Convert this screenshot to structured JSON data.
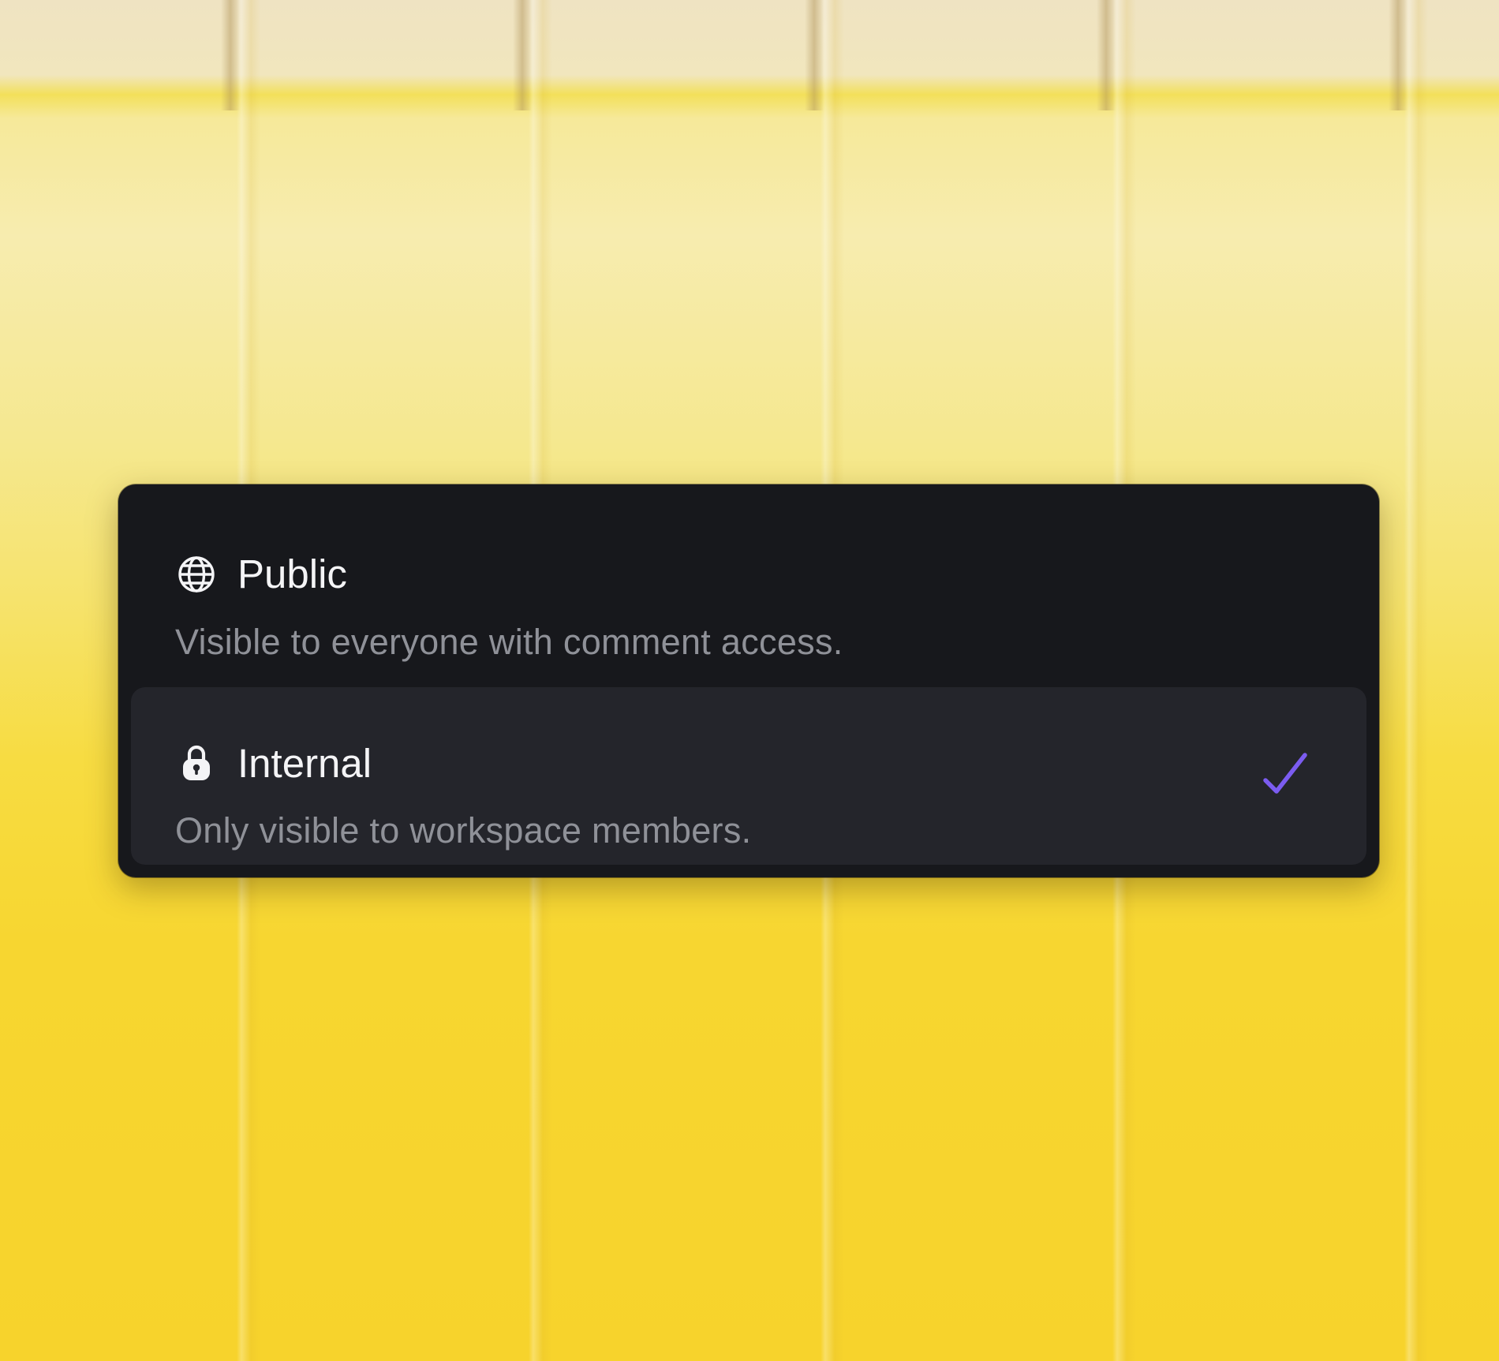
{
  "background": {
    "accent_color": "#f7d630"
  },
  "visibility_menu": {
    "options": [
      {
        "icon": "globe-icon",
        "title": "Public",
        "description": "Visible to everyone with comment access.",
        "selected": false
      },
      {
        "icon": "lock-icon",
        "title": "Internal",
        "description": "Only visible to workspace members.",
        "selected": true
      }
    ],
    "checkmark_color": "#7b5cf0",
    "selected_row_color": "#24252b",
    "panel_color": "#17181c"
  }
}
